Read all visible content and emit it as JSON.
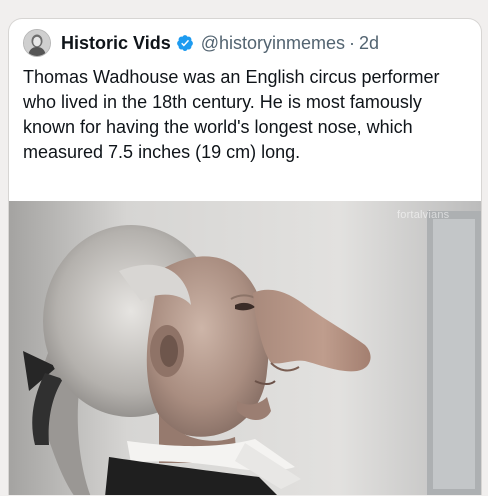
{
  "tweet": {
    "author": {
      "display_name": "Historic Vids",
      "handle": "@historyinmemes",
      "verified": true,
      "avatar_icon": "avatar-portrait-icon"
    },
    "separator": "·",
    "timestamp": "2d",
    "text": "Thomas Wadhouse was an English circus performer who lived in the 18th century. He is most famously known for having the world's longest nose, which measured 7.5 inches (19 cm) long.",
    "media": {
      "watermark": "fortalvians"
    }
  },
  "colors": {
    "text_primary": "#0f1419",
    "text_secondary": "#536471",
    "verified_badge": "#1d9bf0",
    "card_background": "#ffffff",
    "page_background": "#f1efee"
  }
}
